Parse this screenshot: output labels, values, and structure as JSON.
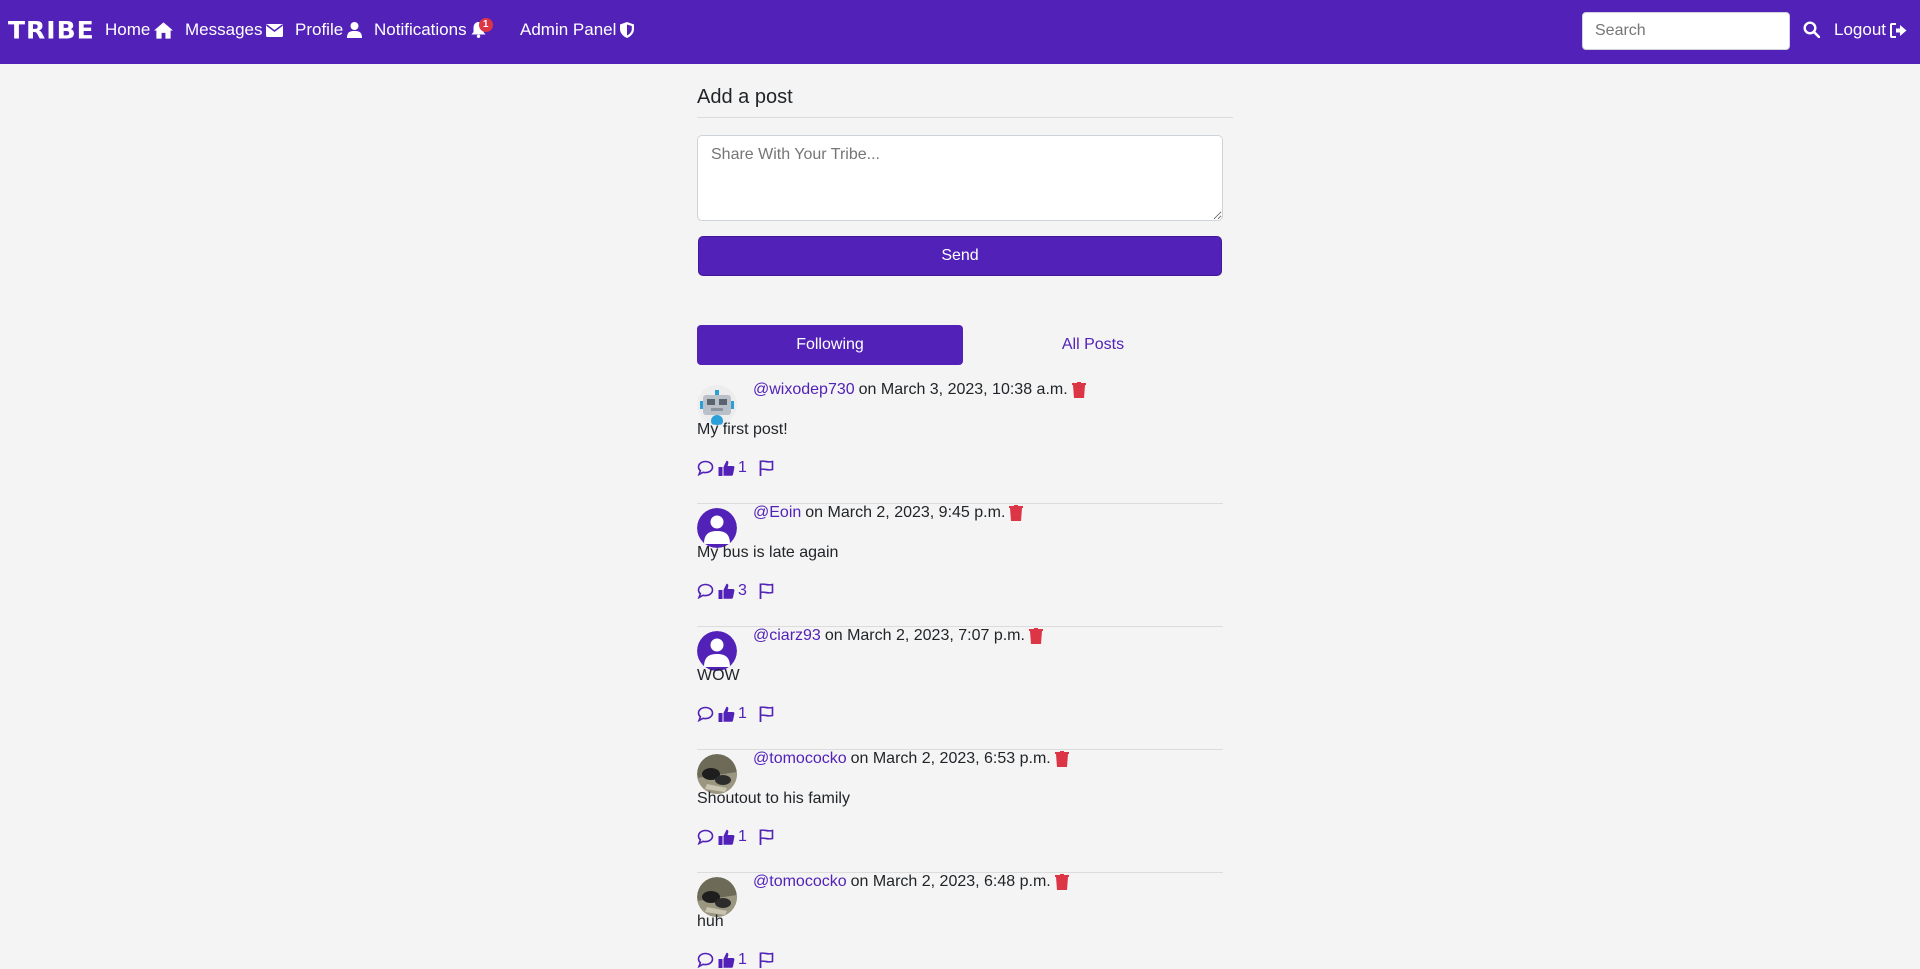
{
  "nav": {
    "brand": "TRIBE",
    "home": "Home",
    "messages": "Messages",
    "profile": "Profile",
    "notifications": "Notifications",
    "notifications_badge": "1",
    "admin_panel": "Admin Panel",
    "search_placeholder": "Search",
    "logout": "Logout"
  },
  "composer": {
    "title": "Add a post",
    "placeholder": "Share With Your Tribe...",
    "send_label": "Send"
  },
  "tabs": {
    "following": "Following",
    "all_posts": "All Posts"
  },
  "posts": [
    {
      "username": "@wixodep730",
      "date": "on March 3, 2023, 10:38 a.m.",
      "body": "My first post!",
      "likes": "1",
      "avatar": "robot-avatar"
    },
    {
      "username": "@Eoin",
      "date": "on March 2, 2023, 9:45 p.m.",
      "body": "My bus is late again",
      "likes": "3",
      "avatar": "default-user-avatar"
    },
    {
      "username": "@ciarz93",
      "date": "on March 2, 2023, 7:07 p.m.",
      "body": "WOW",
      "likes": "1",
      "avatar": "default-user-avatar"
    },
    {
      "username": "@tomococko",
      "date": "on March 2, 2023, 6:53 p.m.",
      "body": "Shoutout to his family",
      "likes": "1",
      "avatar": "photo-avatar"
    },
    {
      "username": "@tomococko",
      "date": "on March 2, 2023, 6:48 p.m.",
      "body": "huh",
      "likes": "1",
      "avatar": "photo-avatar"
    }
  ],
  "colors": {
    "brand": "#5222b8",
    "danger": "#dc3545",
    "background": "#f4f4f4"
  }
}
